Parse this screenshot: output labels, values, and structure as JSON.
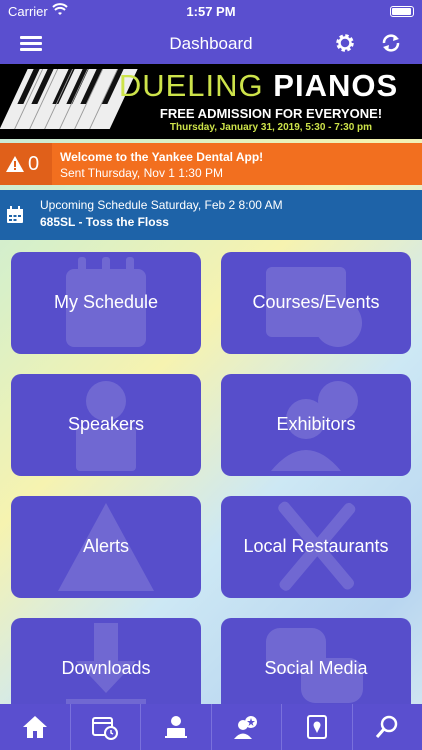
{
  "status": {
    "carrier": "Carrier",
    "time": "1:57 PM"
  },
  "nav": {
    "title": "Dashboard",
    "menu_icon": "hamburger-menu-icon",
    "settings_icon": "gear-icon",
    "refresh_icon": "refresh-icon"
  },
  "banner": {
    "headline_prefix": "DUELING ",
    "headline_bold": "PIANOS",
    "subtitle": "FREE ADMISSION FOR EVERYONE!",
    "date_line": "Thursday, January 31, 2019, 5:30 - 7:30 pm"
  },
  "alert": {
    "count": "0",
    "message": "Welcome to the Yankee Dental App!",
    "sent": "Sent Thursday, Nov 1 1:30 PM"
  },
  "schedule": {
    "header": "Upcoming Schedule Saturday, Feb 2 8:00 AM",
    "item": "685SL - Toss the Floss"
  },
  "tiles": [
    {
      "label": "My Schedule",
      "icon": "schedule-icon"
    },
    {
      "label": "Courses/Events",
      "icon": "calendar-clock-icon"
    },
    {
      "label": "Speakers",
      "icon": "speaker-icon"
    },
    {
      "label": "Exhibitors",
      "icon": "exhibitor-icon"
    },
    {
      "label": "Alerts",
      "icon": "warning-icon"
    },
    {
      "label": "Local Restaurants",
      "icon": "fork-knife-icon"
    },
    {
      "label": "Downloads",
      "icon": "download-icon"
    },
    {
      "label": "Social Media",
      "icon": "chat-bubbles-icon"
    }
  ],
  "tabs": [
    "home-icon",
    "calendar-clock-icon",
    "speaker-icon",
    "exhibitor-icon",
    "map-book-icon",
    "search-icon"
  ],
  "colors": {
    "primary": "#5a4fcf",
    "tile": "#574ecb",
    "alert": "#f26f1f",
    "schedule": "#1e63a8",
    "banner_accent": "#cde34a"
  }
}
